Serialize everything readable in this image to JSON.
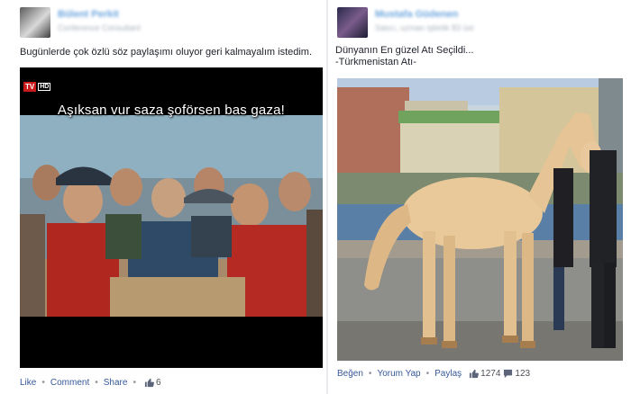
{
  "left_post": {
    "author_name": "Bülent Perkit",
    "author_subtitle": "Conference Consultant",
    "text": "Bugünlerde çok özlü söz paylaşımı oluyor geri kalmayalım istedim.",
    "video_subtitle": "Aşıksan vur saza şoförsen  bas gaza!",
    "channel_logo": "TV",
    "channel_hd": "HD",
    "actions": {
      "like": "Like",
      "comment": "Comment",
      "share": "Share"
    },
    "like_count": "6",
    "like_icon": "thumbs-up-icon"
  },
  "right_post": {
    "author_name": "Mustafa Güdenen",
    "author_subtitle": "Satıcı, uzman işbirlik 83 üst",
    "text": "Dünyanın En güzel Atı Seçildi...\n-Türkmenistan Atı-",
    "actions": {
      "like": "Beğen",
      "comment": "Yorum Yap",
      "share": "Paylaş"
    },
    "like_count": "1274",
    "comment_count": "123",
    "like_icon": "thumbs-up-icon",
    "comment_icon": "comment-bubble-icon"
  },
  "colors": {
    "link": "#365899",
    "author": "#6ea6de",
    "horse": "#e9c99a"
  }
}
